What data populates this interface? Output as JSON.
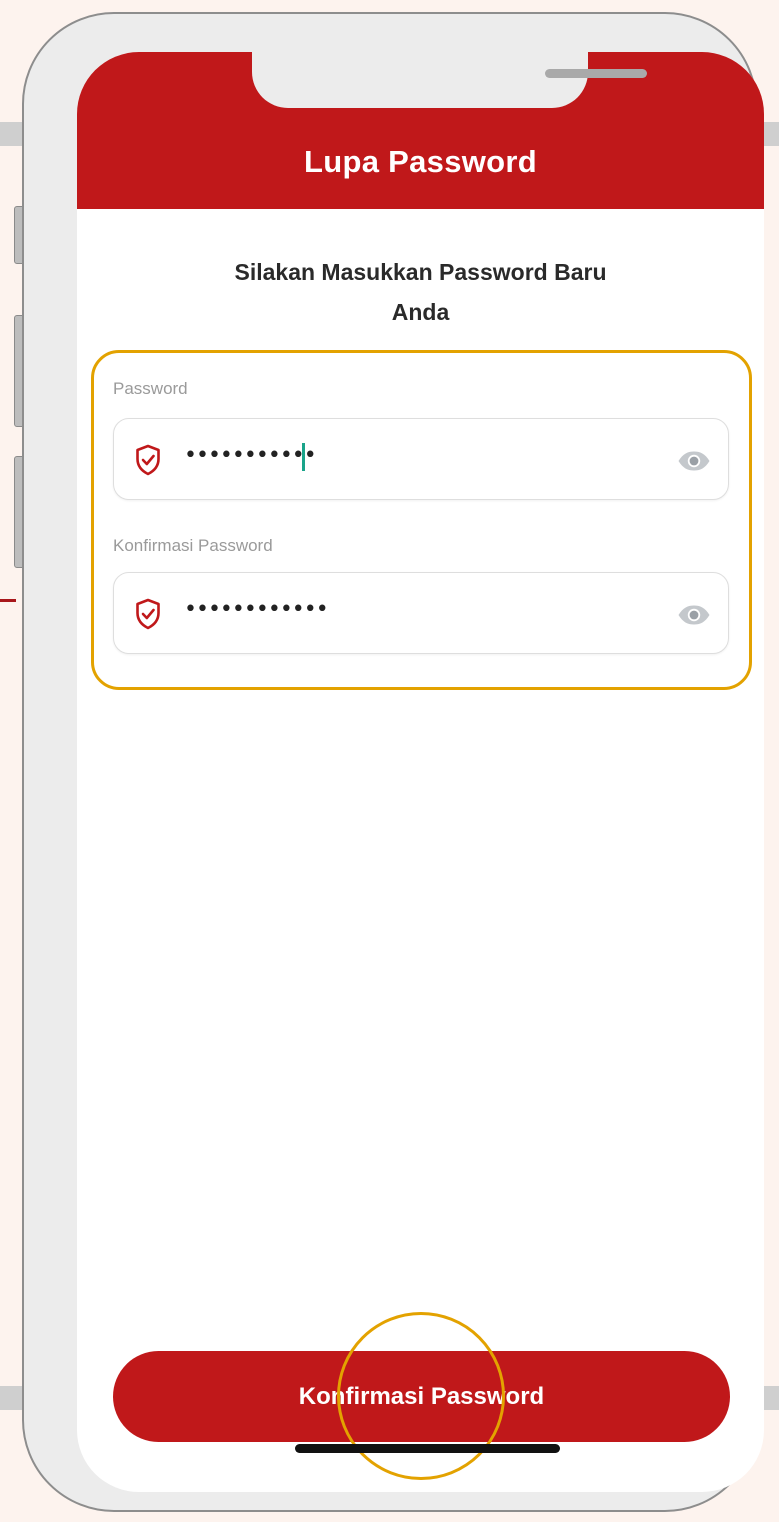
{
  "header": {
    "title": "Lupa Password"
  },
  "subtitle": {
    "line1": "Silakan Masukkan Password Baru",
    "line2": "Anda"
  },
  "fields": {
    "password": {
      "label": "Password",
      "value": "•••••••••••"
    },
    "confirm_password": {
      "label": "Konfirmasi Password",
      "value": "••••••••••••"
    }
  },
  "button": {
    "label": "Konfirmasi Password"
  },
  "colors": {
    "brand_red": "#c0181a",
    "highlight": "#e3a200",
    "caret": "#1aa48a"
  },
  "icons": {
    "field_icon": "shield-check-icon",
    "visibility_icon": "eye-icon"
  }
}
